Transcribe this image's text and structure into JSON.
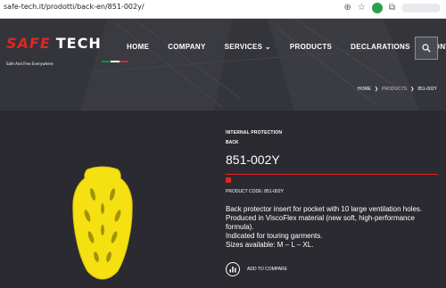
{
  "browser": {
    "url": "safe-tech.it/prodotti/back-en/851-002y/"
  },
  "header": {
    "logo_safe": "SAFE",
    "logo_tech": "TECH",
    "tagline": "Safe And Free Everywhere",
    "nav": [
      "HOME",
      "COMPANY",
      "SERVICES ⌄",
      "PRODUCTS",
      "DECLARATIONS",
      "CONTACTS"
    ],
    "breadcrumb": [
      "HOME",
      "PRODUCTS",
      "851-002Y"
    ]
  },
  "product": {
    "category": "INTERNAL PROTECTION",
    "subcategory": "BACK",
    "title": "851-002Y",
    "code": "PRODUCT CODE: 851-002Y",
    "description": [
      "Back protector insert for pocket with 10 large ventilation holes.",
      "Produced in ViscoFlex material (new soft, high-performance formula).",
      "Indicated for touring garments.",
      "Sizes available: M – L – XL."
    ],
    "compare_label": "ADD TO COMPARE",
    "color": "#f5e012"
  },
  "colors": {
    "accent": "#e42422",
    "background": "#2b2a31"
  }
}
